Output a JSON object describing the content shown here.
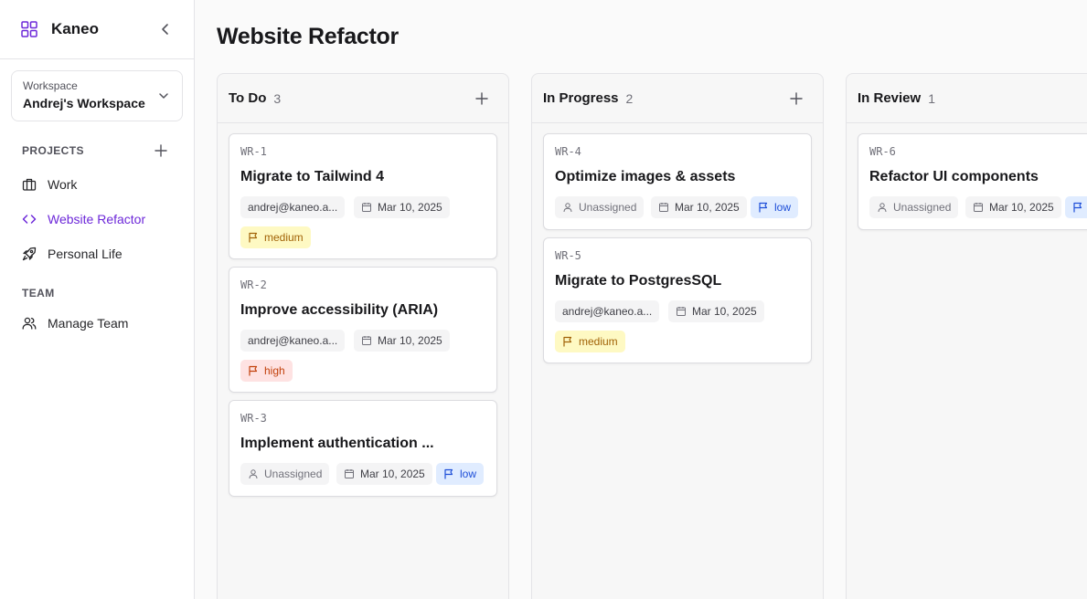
{
  "app": {
    "name": "Kaneo"
  },
  "workspace": {
    "label": "Workspace",
    "name": "Andrej's Workspace"
  },
  "sidebar": {
    "projects_title": "PROJECTS",
    "projects": [
      {
        "label": "Work",
        "icon": "briefcase-icon"
      },
      {
        "label": "Website Refactor",
        "icon": "code-icon",
        "active": true
      },
      {
        "label": "Personal Life",
        "icon": "rocket-icon"
      }
    ],
    "team_title": "TEAM",
    "team_items": [
      {
        "label": "Manage Team",
        "icon": "users-icon"
      }
    ]
  },
  "page": {
    "title": "Website Refactor"
  },
  "columns": [
    {
      "title": "To Do",
      "count": "3",
      "tasks": [
        {
          "id": "WR-1",
          "title": "Migrate to Tailwind 4",
          "assignee": "andrej@kaneo.a...",
          "date": "Mar 10, 2025",
          "priority": "medium"
        },
        {
          "id": "WR-2",
          "title": "Improve accessibility (ARIA)",
          "assignee": "andrej@kaneo.a...",
          "date": "Mar 10, 2025",
          "priority": "high"
        },
        {
          "id": "WR-3",
          "title": "Implement authentication ...",
          "assignee": "Unassigned",
          "date": "Mar 10, 2025",
          "priority": "low"
        }
      ]
    },
    {
      "title": "In Progress",
      "count": "2",
      "tasks": [
        {
          "id": "WR-4",
          "title": "Optimize images & assets",
          "assignee": "Unassigned",
          "date": "Mar 10, 2025",
          "priority": "low"
        },
        {
          "id": "WR-5",
          "title": "Migrate to PostgresSQL",
          "assignee": "andrej@kaneo.a...",
          "date": "Mar 10, 2025",
          "priority": "medium"
        }
      ]
    },
    {
      "title": "In Review",
      "count": "1",
      "tasks": [
        {
          "id": "WR-6",
          "title": "Refactor UI components",
          "assignee": "Unassigned",
          "date": "Mar 10, 2025",
          "priority": "low"
        }
      ]
    }
  ],
  "colors": {
    "accent": "#6d28d9",
    "priority_medium": "#a16207",
    "priority_high": "#c2410c",
    "priority_low": "#1d4ed8"
  }
}
